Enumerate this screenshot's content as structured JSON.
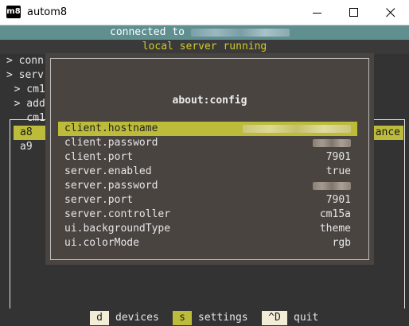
{
  "window": {
    "app_icon_text": "m8",
    "title": "autom8"
  },
  "status": {
    "connected_prefix": "connected to ",
    "server_status": "local server running"
  },
  "tree": [
    {
      "text": "> conn"
    },
    {
      "text": "> serv"
    },
    {
      "text": "  > cm1"
    },
    {
      "text": "  > add"
    },
    {
      "text": "    cm1"
    }
  ],
  "list": {
    "selected_label": "a8",
    "selected_suffix": "ance",
    "second_label": "a9"
  },
  "dialog": {
    "title": "about:config",
    "rows": [
      {
        "key": "client.hostname",
        "value": "",
        "redacted": true
      },
      {
        "key": "client.password",
        "value": "",
        "redacted": true
      },
      {
        "key": "client.port",
        "value": "7901"
      },
      {
        "key": "server.enabled",
        "value": "true"
      },
      {
        "key": "server.password",
        "value": "",
        "redacted": true
      },
      {
        "key": "server.port",
        "value": "7901"
      },
      {
        "key": "server.controller",
        "value": "cm15a"
      },
      {
        "key": "ui.backgroundType",
        "value": "theme"
      },
      {
        "key": "ui.colorMode",
        "value": "rgb"
      }
    ]
  },
  "footer": {
    "items": [
      {
        "key": "d",
        "label": "devices"
      },
      {
        "key": "s",
        "label": "settings"
      },
      {
        "key": "^D",
        "label": "quit"
      }
    ]
  },
  "colors": {
    "accent": "#bcbc3a",
    "status_bar": "#5f8f8f",
    "server_text": "#d4c82c",
    "background": "#333333",
    "dialog_bg": "#4a4441"
  }
}
